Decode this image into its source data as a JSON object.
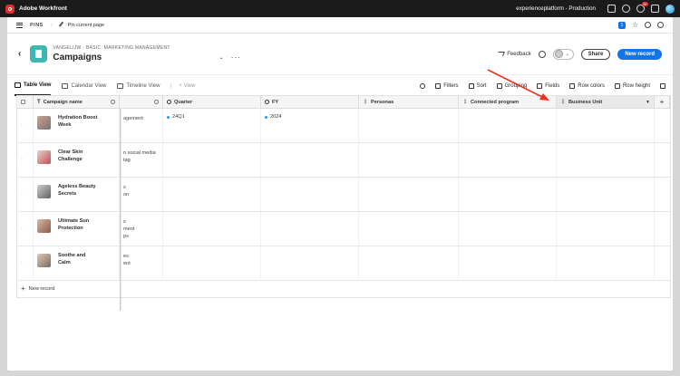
{
  "topbar": {
    "app_name": "Adobe Workfront",
    "environment": "experienceplatform - Production",
    "notif_count": "9+"
  },
  "pins": {
    "label": "PINS",
    "pin_page": "Pin current page",
    "count": "1"
  },
  "header": {
    "breadcrumb": "VANGELIJW - BASIC: MARKETING MANAGEMENT",
    "title": "Campaigns",
    "feedback": "Feedback",
    "share": "Share",
    "new_record": "New record"
  },
  "toolbar": {
    "views": [
      "Table View",
      "Calendar View",
      "Timeline View"
    ],
    "add_view": "View",
    "tools": {
      "filters": "Filters",
      "sort": "Sort",
      "grouping": "Grouping",
      "fields": "Fields",
      "row_colors": "Row colors",
      "row_height": "Row height"
    }
  },
  "table": {
    "columns": {
      "name": "Campaign name",
      "quarter": "Quarter",
      "fy": "FY",
      "personas": "Personas",
      "connected": "Connected program",
      "business_unit": "Business Unit"
    },
    "rows": [
      {
        "name": "Hydration Boost Week",
        "objective": "agement",
        "quarter": "24Q1",
        "fy": "2024"
      },
      {
        "name": "Clear Skin Challenge",
        "objective": "n social media\ntag",
        "quarter": "",
        "fy": ""
      },
      {
        "name": "Ageless Beauty Secrets",
        "objective": "s\non",
        "quarter": "",
        "fy": ""
      },
      {
        "name": "Ultimate Sun Protection",
        "objective": "s\nment\nps",
        "quarter": "",
        "fy": ""
      },
      {
        "name": "Soothe and Calm",
        "objective": "es\nent",
        "quarter": "",
        "fy": ""
      }
    ],
    "new_record": "New record"
  },
  "colors": {
    "accent": "#1473e6",
    "app_icon": "#3fb7b0",
    "annotation": "#e8321d"
  }
}
